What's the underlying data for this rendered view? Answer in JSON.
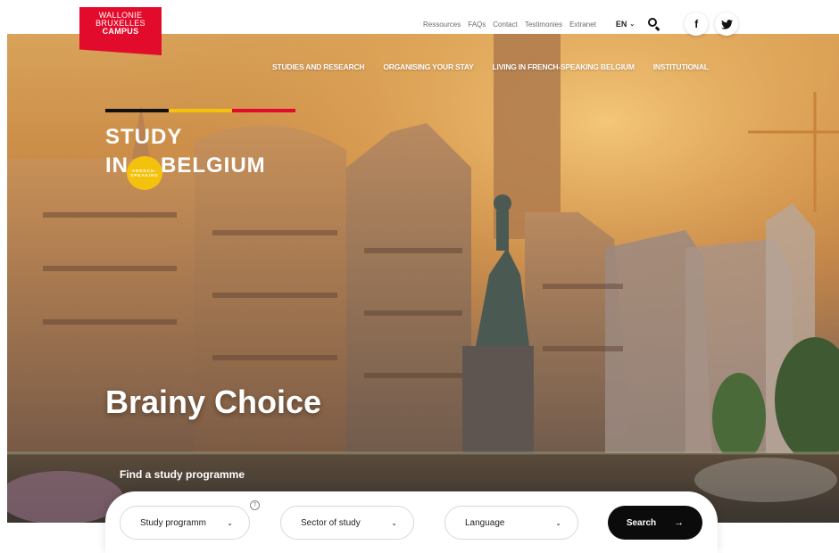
{
  "logo": {
    "line1": "WALLONIE",
    "line2": "BRUXELLES",
    "line3": "CAMPUS"
  },
  "topbar": {
    "links": [
      "Ressources",
      "FAQs",
      "Contact",
      "Testimonies",
      "Extranet"
    ],
    "language": "EN",
    "icons": [
      "search-icon",
      "facebook-icon",
      "twitter-icon"
    ]
  },
  "nav": {
    "items": [
      "STUDIES AND RESEARCH",
      "ORGANISING YOUR STAY",
      "LIVING IN FRENCH-SPEAKING BELGIUM",
      "INSTITUTIONAL"
    ]
  },
  "brand": {
    "line1": "STUDY",
    "line2a": "IN",
    "bubble": "FRENCH-SPEAKING",
    "line2b": "BELGIUM",
    "flag_colors": [
      "#111111",
      "#f4c20d",
      "#e30b2c"
    ]
  },
  "hero": {
    "tagline": "Brainy Choice",
    "find_label": "Find a study programme"
  },
  "search": {
    "study_programme": "Study programme",
    "sector": "Sector of study",
    "language": "Language",
    "info": "?",
    "button": "Search"
  },
  "colors": {
    "accent": "#e30b2c",
    "yellow": "#f4c20d",
    "button": "#0b0b0b"
  }
}
